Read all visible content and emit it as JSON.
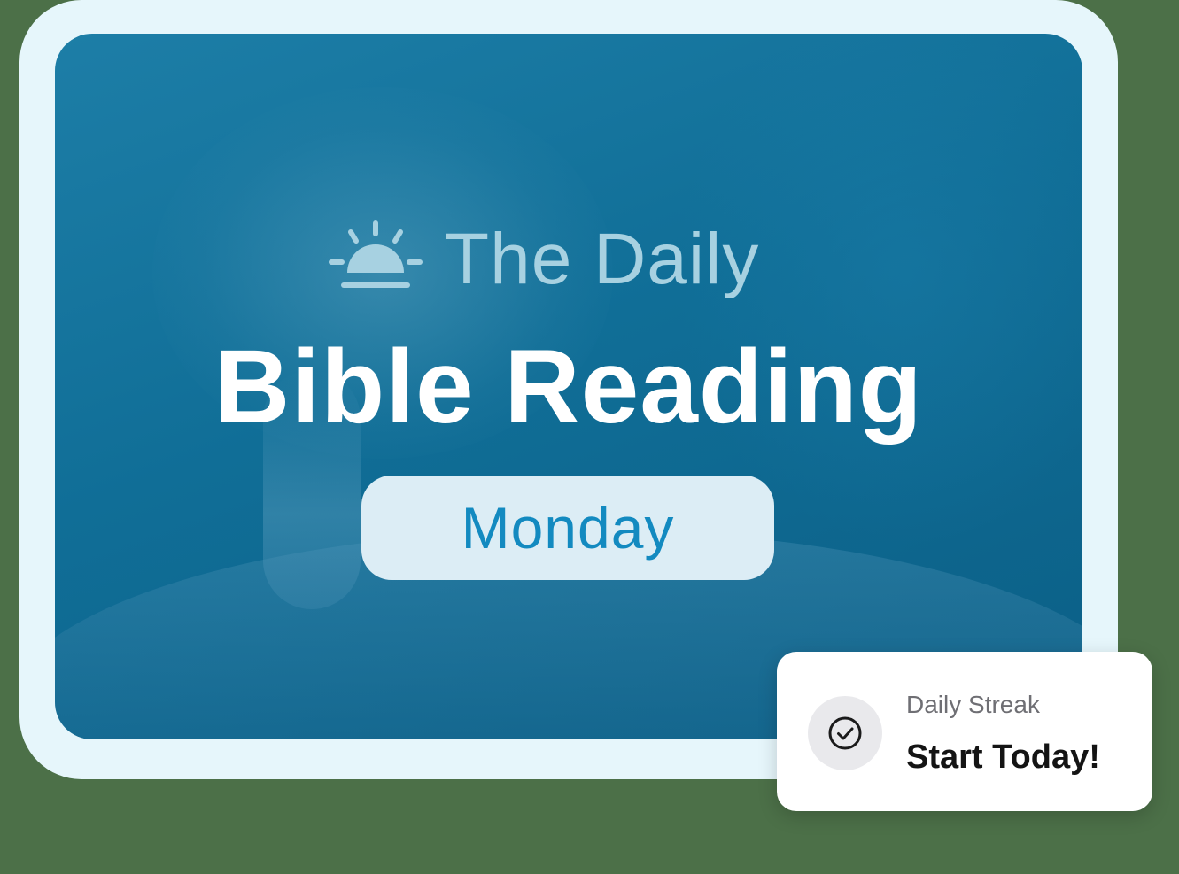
{
  "hero": {
    "brand_text": "The Daily",
    "brand_icon": "sunrise-icon",
    "title": "Bible Reading",
    "day": "Monday"
  },
  "streak": {
    "icon": "check-circle-icon",
    "label": "Daily Streak",
    "value": "Start Today!"
  },
  "colors": {
    "card_blue": "#106e97",
    "frame": "#e6f6fb",
    "brand_text": "#a7d1e1",
    "pill_bg": "#dcedf5",
    "pill_text": "#138ac0"
  }
}
